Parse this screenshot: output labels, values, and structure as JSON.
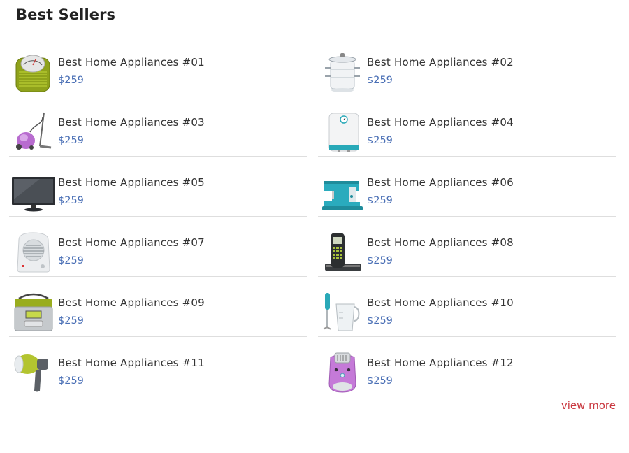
{
  "section": {
    "title": "Best Sellers",
    "view_more_label": "view more"
  },
  "colors": {
    "price": "#4a6fb5",
    "view_more": "#c9373f",
    "divider": "#dedede"
  },
  "products": [
    {
      "name": "Best Home Appliances #01",
      "price": "$259",
      "icon": "bathroom-scale-icon"
    },
    {
      "name": "Best Home Appliances #02",
      "price": "$259",
      "icon": "steamer-pot-icon"
    },
    {
      "name": "Best Home Appliances #03",
      "price": "$259",
      "icon": "vacuum-cleaner-icon"
    },
    {
      "name": "Best Home Appliances #04",
      "price": "$259",
      "icon": "water-heater-icon"
    },
    {
      "name": "Best Home Appliances #05",
      "price": "$259",
      "icon": "television-icon"
    },
    {
      "name": "Best Home Appliances #06",
      "price": "$259",
      "icon": "sewing-machine-icon"
    },
    {
      "name": "Best Home Appliances #07",
      "price": "$259",
      "icon": "fan-heater-icon"
    },
    {
      "name": "Best Home Appliances #08",
      "price": "$259",
      "icon": "cordless-phone-icon"
    },
    {
      "name": "Best Home Appliances #09",
      "price": "$259",
      "icon": "rice-cooker-icon"
    },
    {
      "name": "Best Home Appliances #10",
      "price": "$259",
      "icon": "hand-blender-icon"
    },
    {
      "name": "Best Home Appliances #11",
      "price": "$259",
      "icon": "hair-dryer-icon"
    },
    {
      "name": "Best Home Appliances #12",
      "price": "$259",
      "icon": "epilator-icon"
    }
  ]
}
